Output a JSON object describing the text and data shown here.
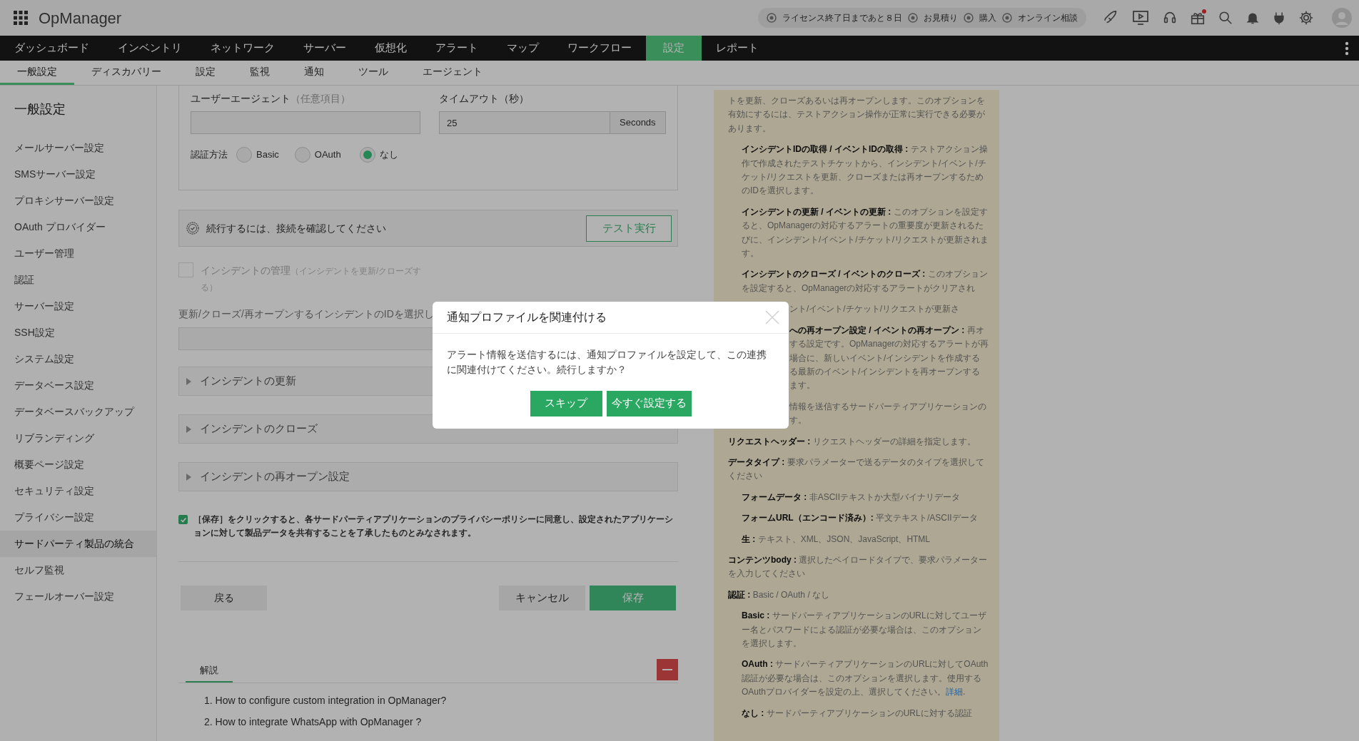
{
  "header": {
    "app_name": "OpManager",
    "notices": [
      {
        "text": "ライセンス終了日まであと８日"
      },
      {
        "text": "お見積り"
      },
      {
        "text": "購入"
      },
      {
        "text": "オンライン相談"
      }
    ],
    "gift_badge": true
  },
  "nav": [
    {
      "label": "ダッシュボード",
      "selected": false
    },
    {
      "label": "インベントリ",
      "selected": false
    },
    {
      "label": "ネットワーク",
      "selected": false
    },
    {
      "label": "サーバー",
      "selected": false
    },
    {
      "label": "仮想化",
      "selected": false
    },
    {
      "label": "アラート",
      "selected": false
    },
    {
      "label": "マップ",
      "selected": false
    },
    {
      "label": "ワークフロー",
      "selected": false
    },
    {
      "label": "設定",
      "selected": true
    },
    {
      "label": "レポート",
      "selected": false
    }
  ],
  "subnav": [
    {
      "label": "一般設定",
      "selected": true
    },
    {
      "label": "ディスカバリー",
      "selected": false
    },
    {
      "label": "設定",
      "selected": false
    },
    {
      "label": "監視",
      "selected": false
    },
    {
      "label": "通知",
      "selected": false
    },
    {
      "label": "ツール",
      "selected": false
    },
    {
      "label": "エージェント",
      "selected": false
    }
  ],
  "sidebar": {
    "title": "一般設定",
    "items": [
      {
        "label": "メールサーバー設定",
        "selected": false
      },
      {
        "label": "SMSサーバー設定",
        "selected": false
      },
      {
        "label": "プロキシサーバー設定",
        "selected": false
      },
      {
        "label": "OAuth プロバイダー",
        "selected": false
      },
      {
        "label": "ユーザー管理",
        "selected": false
      },
      {
        "label": "認証",
        "selected": false
      },
      {
        "label": "サーバー設定",
        "selected": false
      },
      {
        "label": "SSH設定",
        "selected": false
      },
      {
        "label": "システム設定",
        "selected": false
      },
      {
        "label": "データベース設定",
        "selected": false
      },
      {
        "label": "データベースバックアップ",
        "selected": false
      },
      {
        "label": "リブランディング",
        "selected": false
      },
      {
        "label": "概要ページ設定",
        "selected": false
      },
      {
        "label": "セキュリティ設定",
        "selected": false
      },
      {
        "label": "プライバシー設定",
        "selected": false
      },
      {
        "label": "サードパーティ製品の統合",
        "selected": true
      },
      {
        "label": "セルフ監視",
        "selected": false
      },
      {
        "label": "フェールオーバー設定",
        "selected": false
      }
    ]
  },
  "form": {
    "user_agent_label": "ユーザーエージェント",
    "user_agent_hint": "（任意項目）",
    "timeout_label": "タイムアウト（秒）",
    "timeout_value": "25",
    "timeout_unit": "Seconds",
    "auth_label": "認証方法",
    "auth_options": [
      {
        "label": "Basic",
        "selected": false
      },
      {
        "label": "OAuth",
        "selected": false
      },
      {
        "label": "なし",
        "selected": true
      }
    ],
    "test_message": "続行するには、接続を確認してください",
    "test_button": "テスト実行",
    "incident_management": {
      "label": "インシデントの管理",
      "hint": "（インシデントを更新/クローズする）",
      "checked": false
    },
    "id_select_label": "更新/クローズ/再オープンするインシデントのIDを選択し",
    "accordions": [
      "インシデントの更新",
      "インシデントのクローズ",
      "インシデントの再オープン設定"
    ],
    "consent": {
      "checked": true,
      "text": "［保存］をクリックすると、各サードパーティアプリケーションのプライバシーポリシーに同意し、設定されたアプリケーションに対して製品データを共有することを了承したものとみなされます。"
    },
    "buttons": {
      "back": "戻る",
      "cancel": "キャンセル",
      "save": "保存"
    }
  },
  "explanation": {
    "tab": "解説",
    "links": [
      "1. How to configure custom integration in OpManager?",
      "2. How to integrate WhatsApp with OpManager ?"
    ]
  },
  "help": [
    {
      "kind": "para",
      "text": "トを更新、クローズあるいは再オープンします。このオプションを有効にするには、テストアクション操作が正常に実行できる必要があります。",
      "children": [
        {
          "kind": "para",
          "title": "インシデントIDの取得 / イベントIDの取得 :",
          "text": "テストアクション操作で作成されたテストチケットから、インシデント/イベント/チケット/リクエストを更新、クローズまたは再オープンするためのIDを選択します。"
        },
        {
          "kind": "para",
          "title": "インシデントの更新 / イベントの更新 :",
          "text": "このオプションを設定すると、OpManagerの対応するアラートの重要度が更新されるたびに、インシデント/イベント/チケット/リクエストが更新されます。"
        },
        {
          "kind": "para",
          "title": "インシデントのクローズ / イベントのクローズ :",
          "text": "このオプションを設定すると、OpManagerの対応するアラートがクリアされ"
        },
        {
          "kind": "fragment",
          "lines": [
            {
              "text": "ント/イベント/チケット/リクエストが更新さ"
            }
          ]
        },
        {
          "kind": "fragment",
          "lines": [
            {
              "title": "への再オープン設定 / イベントの再オープン :",
              "text": "再オ"
            },
            {
              "text": "する設定です。OpManagerの対応するアラートが再"
            },
            {
              "text": "場合に、新しいイベント/インシデントを作成する"
            },
            {
              "text": "る最新のイベント/インシデントを再オープンする"
            },
            {
              "text": "ます。"
            }
          ]
        }
      ]
    },
    {
      "kind": "fragment",
      "lines": [
        {
          "text": "情報を送信するサードパーティアプリケーションの"
        },
        {
          "text": "す。"
        }
      ]
    },
    {
      "kind": "para",
      "title": "リクエストヘッダー :",
      "text": "リクエストヘッダーの詳細を指定します。"
    },
    {
      "kind": "para",
      "title": "データタイプ :",
      "text": "要求パラメーターで送るデータのタイプを選択してください",
      "children": [
        {
          "kind": "para",
          "title": "フォームデータ :",
          "text": "非ASCIIテキストか大型バイナリデータ"
        },
        {
          "kind": "para",
          "title": "フォームURL（エンコード済み）:",
          "text": "平文テキスト/ASCIIデータ"
        },
        {
          "kind": "para",
          "title": "生 :",
          "text": "テキスト、XML、JSON、JavaScript、HTML"
        }
      ]
    },
    {
      "kind": "para",
      "title": "コンテンツbody :",
      "text": "選択したペイロードタイプで、要求パラメーターを入力してください"
    },
    {
      "kind": "para",
      "title": "認証 :",
      "text": "Basic / OAuth / なし",
      "children": [
        {
          "kind": "para",
          "title": "Basic :",
          "text": "サードパーティアプリケーションのURLに対してユーザー名とパスワードによる認証が必要な場合は、このオプションを選択します。"
        },
        {
          "kind": "para",
          "title": "OAuth :",
          "text": "サードパーティアプリケーションのURLに対してOAuth認証が必要な場合は、このオプションを選択します。使用するOAuthプロバイダーを設定の上、選択してください。",
          "link": "詳細",
          "after": "."
        },
        {
          "kind": "para",
          "title": "なし :",
          "text": "サードパーティアプリケーションのURLに対する認証"
        }
      ]
    }
  ],
  "modal": {
    "title": "通知プロファイルを関連付ける",
    "message": "アラート情報を送信するには、通知プロファイルを設定して、この連携に関連付けてください。続行しますか？",
    "buttons": [
      "スキップ",
      "今すぐ設定する"
    ]
  }
}
